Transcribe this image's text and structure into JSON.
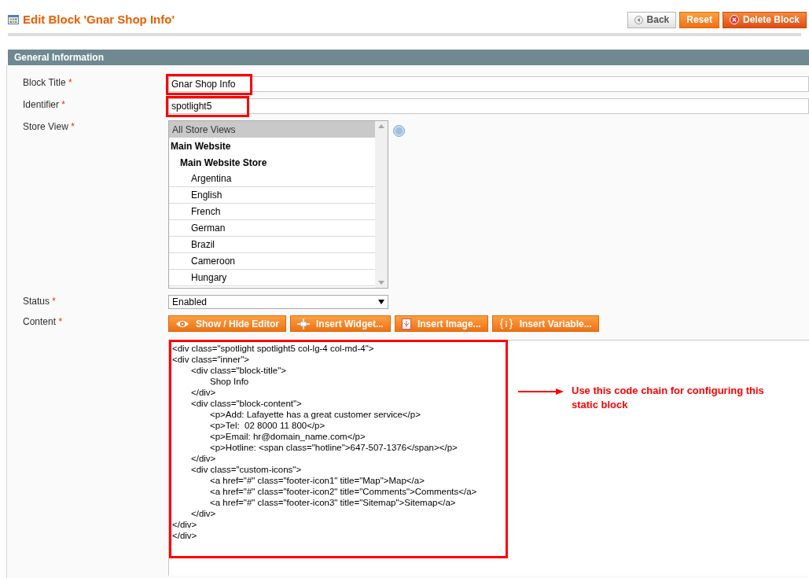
{
  "page_title": "Edit Block 'Gnar Shop Info'",
  "header_buttons": [
    {
      "label": "Back",
      "kind": "back"
    },
    {
      "label": "Reset",
      "kind": "reset"
    },
    {
      "label": "Delete Block",
      "kind": "delete"
    }
  ],
  "section": {
    "title": "General Information"
  },
  "fields": [
    {
      "kind": "text",
      "label": "Block Title",
      "required": "*",
      "value": "Gnar Shop Info",
      "highlighted": true
    },
    {
      "kind": "text",
      "label": "Identifier",
      "required": "*",
      "value": "spotlight5",
      "highlighted": true
    },
    {
      "kind": "multiselect",
      "label": "Store View",
      "required": "*",
      "options": [
        {
          "label": "All Store Views",
          "selected": true
        },
        {
          "label": "Main Website",
          "selected": false,
          "children": [
            {
              "label": "Main Website Store",
              "selected": false,
              "children": [
                {
                  "label": "Argentina",
                  "selected": false
                },
                {
                  "label": "English",
                  "selected": false
                },
                {
                  "label": "French",
                  "selected": false
                },
                {
                  "label": "German",
                  "selected": false
                },
                {
                  "label": "Brazil",
                  "selected": false
                },
                {
                  "label": "Cameroon",
                  "selected": false
                },
                {
                  "label": "Hungary",
                  "selected": false
                }
              ]
            }
          ]
        }
      ]
    },
    {
      "kind": "select",
      "label": "Status",
      "required": "*",
      "value": "Enabled"
    },
    {
      "kind": "editor",
      "label": "Content",
      "required": "*",
      "highlighted": true,
      "toolbar": [
        {
          "label": "Show / Hide Editor",
          "kind": "eye"
        },
        {
          "label": "Insert Widget...",
          "kind": "widget"
        },
        {
          "label": "Insert Image...",
          "kind": "image"
        },
        {
          "label": "Insert Variable...",
          "kind": "variable"
        }
      ],
      "code_lines": [
        "<div class=\"spotlight spotlight5 col-lg-4 col-md-4\">",
        "<div class=\"inner\">",
        "\t<div class=\"block-title\">",
        "\t\tShop Info",
        "\t</div>",
        "\t<div class=\"block-content\">",
        "\t\t<p>Add: Lafayette has a great customer service</p>",
        "\t\t<p>Tel:  02 8000 11 800</p>",
        "\t\t<p>Email: hr@domain_name.com</p>",
        "\t\t<p>Hotline: <span class=\"hotline\">647-507-1376</span></p>",
        "\t</div>",
        "\t<div class=\"custom-icons\">",
        "\t\t<a href=\"#\" class=\"footer-icon1\" title=\"Map\">Map</a>",
        "\t\t<a href=\"#\" class=\"footer-icon2\" title=\"Comments\">Comments</a>",
        "\t\t<a href=\"#\" class=\"footer-icon3\" title=\"Sitemap\">Sitemap</a>",
        "\t</div>",
        "</div>",
        "</div>"
      ],
      "note": "Use this code chain for configuring this static block"
    }
  ]
}
